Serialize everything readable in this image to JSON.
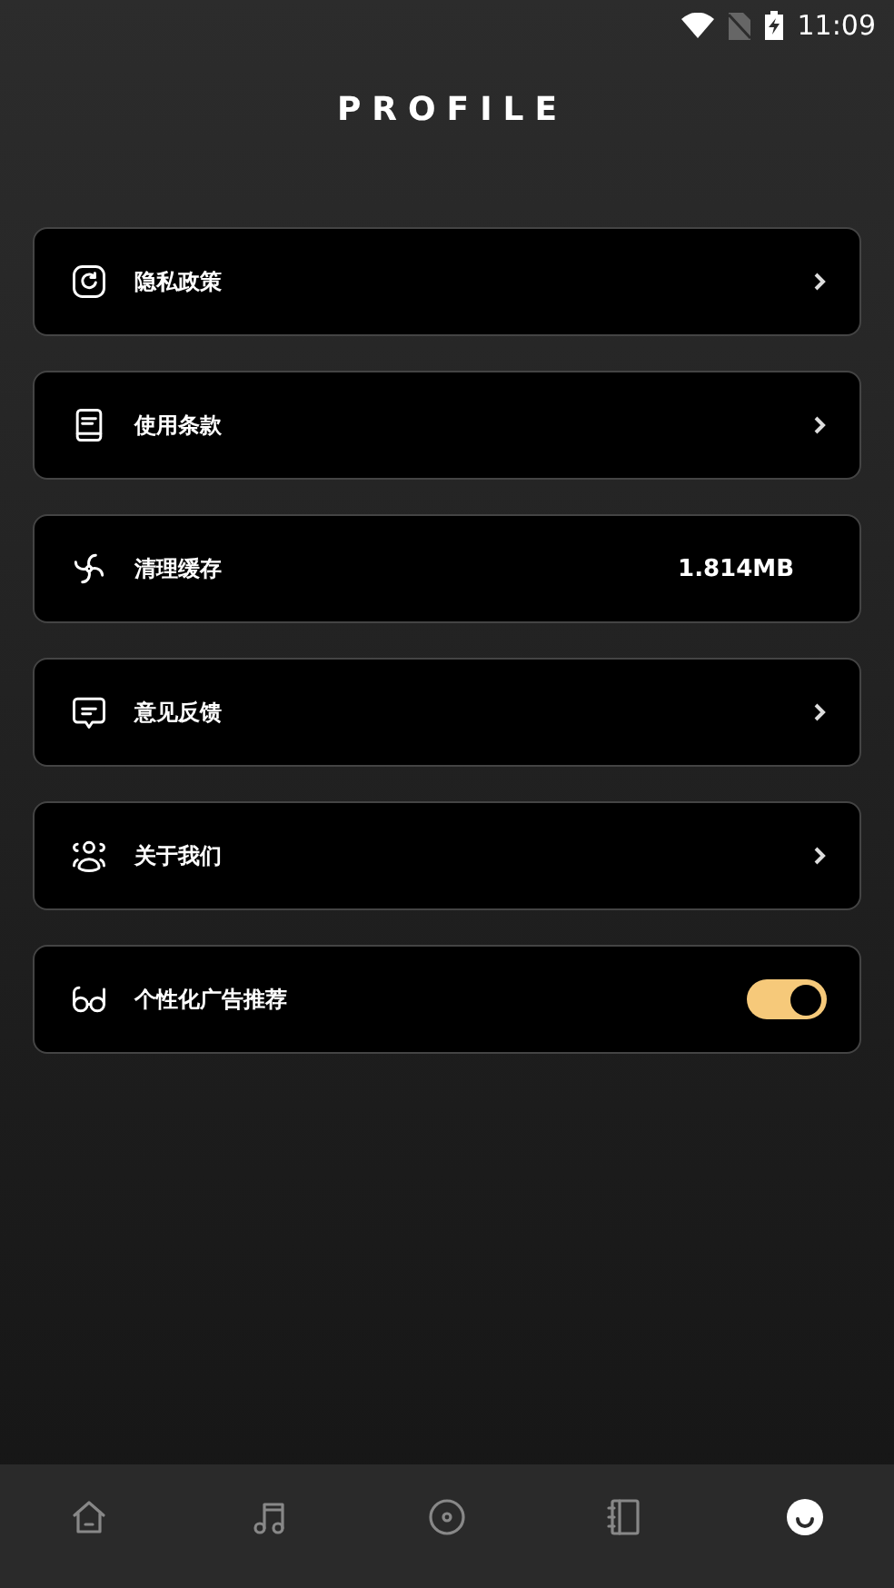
{
  "status_bar": {
    "time": "11:09"
  },
  "title": "PROFILE",
  "items": [
    {
      "label": "隐私政策",
      "kind": "link"
    },
    {
      "label": "使用条款",
      "kind": "link"
    },
    {
      "label": "清理缓存",
      "kind": "value",
      "value": "1.814MB"
    },
    {
      "label": "意见反馈",
      "kind": "link"
    },
    {
      "label": "关于我们",
      "kind": "link"
    },
    {
      "label": "个性化广告推荐",
      "kind": "toggle",
      "on": true
    }
  ],
  "nav": [
    {
      "selected": false
    },
    {
      "selected": false
    },
    {
      "selected": false
    },
    {
      "selected": false
    },
    {
      "selected": true
    }
  ]
}
